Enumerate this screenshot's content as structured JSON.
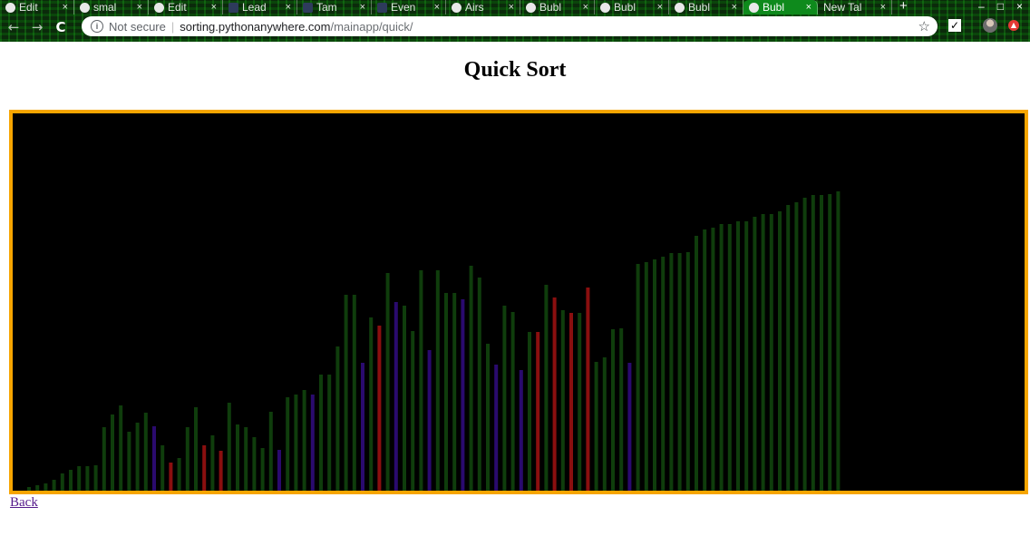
{
  "browser": {
    "tabs": [
      {
        "title": "Edit",
        "icon": "globe-icon"
      },
      {
        "title": "smal",
        "icon": "globe-icon"
      },
      {
        "title": "Edit",
        "icon": "globe-icon"
      },
      {
        "title": "Lead",
        "icon": "app-icon"
      },
      {
        "title": "Tam",
        "icon": "app-icon"
      },
      {
        "title": "Even",
        "icon": "app-icon"
      },
      {
        "title": "Airs",
        "icon": "globe-icon"
      },
      {
        "title": "Bubl",
        "icon": "globe-icon"
      },
      {
        "title": "Bubl",
        "icon": "globe-icon"
      },
      {
        "title": "Bubl",
        "icon": "globe-icon"
      },
      {
        "title": "Bubl",
        "icon": "globe-icon",
        "active": true
      },
      {
        "title": "New Tal",
        "icon": "none"
      }
    ],
    "tab_close_glyph": "×",
    "new_tab_glyph": "+",
    "security_label": "Not secure",
    "url_host": "sorting.pythonanywhere.com",
    "url_path": "/mainapp/quick/",
    "info_glyph": "i",
    "star_glyph": "☆"
  },
  "page": {
    "title": "Quick Sort",
    "back_link": "Back"
  },
  "colors": {
    "canvas_border": "#f6a500",
    "canvas_bg": "#000000",
    "sorted_bar": "#0f3d0c",
    "compare_bar": "#8a0f0f",
    "active_bar": "#2a0a6e"
  },
  "bars": [
    {
      "v": 0.01,
      "s": "g"
    },
    {
      "v": 0.015,
      "s": "g"
    },
    {
      "v": 0.02,
      "s": "g"
    },
    {
      "v": 0.028,
      "s": "g"
    },
    {
      "v": 0.045,
      "s": "g"
    },
    {
      "v": 0.056,
      "s": "g"
    },
    {
      "v": 0.064,
      "s": "g"
    },
    {
      "v": 0.066,
      "s": "g"
    },
    {
      "v": 0.067,
      "s": "g"
    },
    {
      "v": 0.169,
      "s": "g"
    },
    {
      "v": 0.202,
      "s": "g"
    },
    {
      "v": 0.227,
      "s": "g"
    },
    {
      "v": 0.157,
      "s": "g"
    },
    {
      "v": 0.181,
      "s": "g"
    },
    {
      "v": 0.207,
      "s": "g"
    },
    {
      "v": 0.171,
      "s": "p"
    },
    {
      "v": 0.119,
      "s": "g"
    },
    {
      "v": 0.074,
      "s": "r"
    },
    {
      "v": 0.087,
      "s": "g"
    },
    {
      "v": 0.169,
      "s": "g"
    },
    {
      "v": 0.222,
      "s": "g"
    },
    {
      "v": 0.119,
      "s": "r"
    },
    {
      "v": 0.147,
      "s": "g"
    },
    {
      "v": 0.106,
      "s": "r"
    },
    {
      "v": 0.232,
      "s": "g"
    },
    {
      "v": 0.176,
      "s": "g"
    },
    {
      "v": 0.169,
      "s": "g"
    },
    {
      "v": 0.142,
      "s": "g"
    },
    {
      "v": 0.114,
      "s": "g"
    },
    {
      "v": 0.21,
      "s": "g"
    },
    {
      "v": 0.109,
      "s": "p"
    },
    {
      "v": 0.248,
      "s": "g"
    },
    {
      "v": 0.256,
      "s": "g"
    },
    {
      "v": 0.266,
      "s": "g"
    },
    {
      "v": 0.256,
      "s": "p"
    },
    {
      "v": 0.307,
      "s": "g"
    },
    {
      "v": 0.307,
      "s": "g"
    },
    {
      "v": 0.382,
      "s": "g"
    },
    {
      "v": 0.52,
      "s": "g"
    },
    {
      "v": 0.52,
      "s": "g"
    },
    {
      "v": 0.34,
      "s": "p"
    },
    {
      "v": 0.458,
      "s": "g"
    },
    {
      "v": 0.438,
      "s": "r"
    },
    {
      "v": 0.576,
      "s": "g"
    },
    {
      "v": 0.499,
      "s": "p"
    },
    {
      "v": 0.491,
      "s": "g"
    },
    {
      "v": 0.422,
      "s": "g"
    },
    {
      "v": 0.584,
      "s": "g"
    },
    {
      "v": 0.373,
      "s": "p"
    },
    {
      "v": 0.584,
      "s": "g"
    },
    {
      "v": 0.523,
      "s": "g"
    },
    {
      "v": 0.523,
      "s": "g"
    },
    {
      "v": 0.507,
      "s": "p"
    },
    {
      "v": 0.596,
      "s": "g"
    },
    {
      "v": 0.564,
      "s": "g"
    },
    {
      "v": 0.389,
      "s": "g"
    },
    {
      "v": 0.335,
      "s": "p"
    },
    {
      "v": 0.491,
      "s": "g"
    },
    {
      "v": 0.474,
      "s": "g"
    },
    {
      "v": 0.32,
      "s": "p"
    },
    {
      "v": 0.421,
      "s": "g"
    },
    {
      "v": 0.421,
      "s": "r"
    },
    {
      "v": 0.545,
      "s": "g"
    },
    {
      "v": 0.511,
      "s": "r"
    },
    {
      "v": 0.479,
      "s": "g"
    },
    {
      "v": 0.471,
      "s": "r"
    },
    {
      "v": 0.471,
      "s": "g"
    },
    {
      "v": 0.538,
      "s": "r"
    },
    {
      "v": 0.341,
      "s": "g"
    },
    {
      "v": 0.354,
      "s": "g"
    },
    {
      "v": 0.429,
      "s": "g"
    },
    {
      "v": 0.43,
      "s": "g"
    },
    {
      "v": 0.34,
      "s": "p"
    },
    {
      "v": 0.6,
      "s": "g"
    },
    {
      "v": 0.605,
      "s": "g"
    },
    {
      "v": 0.613,
      "s": "g"
    },
    {
      "v": 0.619,
      "s": "g"
    },
    {
      "v": 0.63,
      "s": "g"
    },
    {
      "v": 0.63,
      "s": "g"
    },
    {
      "v": 0.632,
      "s": "g"
    },
    {
      "v": 0.675,
      "s": "g"
    },
    {
      "v": 0.692,
      "s": "g"
    },
    {
      "v": 0.697,
      "s": "g"
    },
    {
      "v": 0.707,
      "s": "g"
    },
    {
      "v": 0.707,
      "s": "g"
    },
    {
      "v": 0.714,
      "s": "g"
    },
    {
      "v": 0.714,
      "s": "g"
    },
    {
      "v": 0.727,
      "s": "g"
    },
    {
      "v": 0.732,
      "s": "g"
    },
    {
      "v": 0.734,
      "s": "g"
    },
    {
      "v": 0.741,
      "s": "g"
    },
    {
      "v": 0.757,
      "s": "g"
    },
    {
      "v": 0.764,
      "s": "g"
    },
    {
      "v": 0.776,
      "s": "g"
    },
    {
      "v": 0.784,
      "s": "g"
    },
    {
      "v": 0.784,
      "s": "g"
    },
    {
      "v": 0.786,
      "s": "g"
    },
    {
      "v": 0.793,
      "s": "g"
    }
  ]
}
